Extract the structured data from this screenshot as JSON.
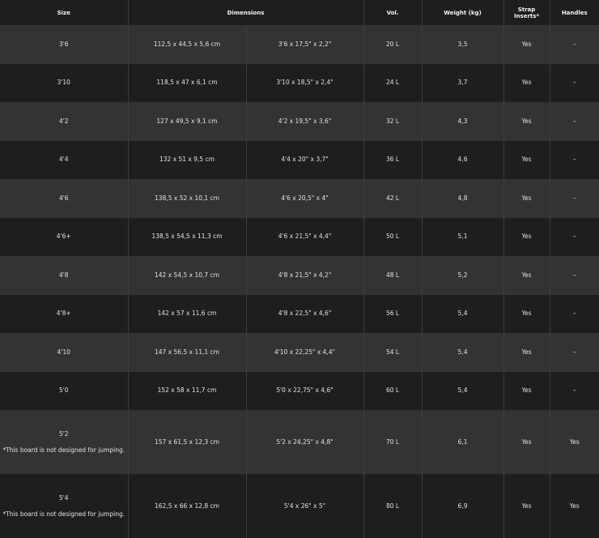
{
  "headers": {
    "size": "Size",
    "dimensions": "Dimensions",
    "vol": "Vol.",
    "weight": "Weight (kg)",
    "strap": "Strap Inserts*",
    "handles": "Handles"
  },
  "rows": [
    {
      "size": "3'6",
      "note": "",
      "metric": "112,5 x 44,5 x 5,6 cm",
      "imperial": "3'6 x 17,5\" x 2,2\"",
      "vol": "20 L",
      "weight": "3,5",
      "strap": "Yes",
      "handles": "–"
    },
    {
      "size": "3'10",
      "note": "",
      "metric": "118,5 x 47 x 6,1 cm",
      "imperial": "3'10 x 18,5\" x 2,4\"",
      "vol": "24 L",
      "weight": "3,7",
      "strap": "Yes",
      "handles": "–"
    },
    {
      "size": "4'2",
      "note": "",
      "metric": "127 x 49,5 x 9,1 cm",
      "imperial": "4'2 x 19,5\" x 3,6\"",
      "vol": "32 L",
      "weight": "4,3",
      "strap": "Yes",
      "handles": "–"
    },
    {
      "size": "4'4",
      "note": "",
      "metric": "132 x 51 x 9,5 cm",
      "imperial": "4'4 x 20\" x 3,7\"",
      "vol": "36 L",
      "weight": "4,6",
      "strap": "Yes",
      "handles": "–"
    },
    {
      "size": "4'6",
      "note": "",
      "metric": "138,5 x 52 x 10,1 cm",
      "imperial": "4'6 x 20,5\" x 4\"",
      "vol": "42 L",
      "weight": "4,8",
      "strap": "Yes",
      "handles": "–"
    },
    {
      "size": "4'6+",
      "note": "",
      "metric": "138,5 x 54,5 x 11,3 cm",
      "imperial": "4'6 x 21,5\" x 4,4\"",
      "vol": "50 L",
      "weight": "5,1",
      "strap": "Yes",
      "handles": "–"
    },
    {
      "size": "4'8",
      "note": "",
      "metric": "142 x 54,5 x 10,7 cm",
      "imperial": "4'8 x 21,5\" x 4,2\"",
      "vol": "48 L",
      "weight": "5,2",
      "strap": "Yes",
      "handles": "–"
    },
    {
      "size": "4'8+",
      "note": "",
      "metric": "142 x 57 x 11,6 cm",
      "imperial": "4'8 x 22,5\" x 4,6\"",
      "vol": "56 L",
      "weight": "5,4",
      "strap": "Yes",
      "handles": "–"
    },
    {
      "size": "4'10",
      "note": "",
      "metric": "147 x 56,5 x 11,1 cm",
      "imperial": "4'10 x 22,25\" x 4,4\"",
      "vol": "54 L",
      "weight": "5,4",
      "strap": "Yes",
      "handles": "–"
    },
    {
      "size": "5'0",
      "note": "",
      "metric": "152 x 58 x 11,7 cm",
      "imperial": "5'0 x 22,75\" x 4,6\"",
      "vol": "60 L",
      "weight": "5,4",
      "strap": "Yes",
      "handles": "–"
    },
    {
      "size": "5'2",
      "note": "*This board is not designed for jumping.",
      "metric": "157 x 61,5 x 12,3 cm",
      "imperial": "5'2 x 24,25\" x 4,8\"",
      "vol": "70 L",
      "weight": "6,1",
      "strap": "Yes",
      "handles": "Yes"
    },
    {
      "size": "5'4",
      "note": "*This board is not designed for jumping.",
      "metric": "162,5 x 66 x 12,8 cm",
      "imperial": "5'4 x 26\" x 5\"",
      "vol": "80 L",
      "weight": "6,9",
      "strap": "Yes",
      "handles": "Yes"
    }
  ]
}
